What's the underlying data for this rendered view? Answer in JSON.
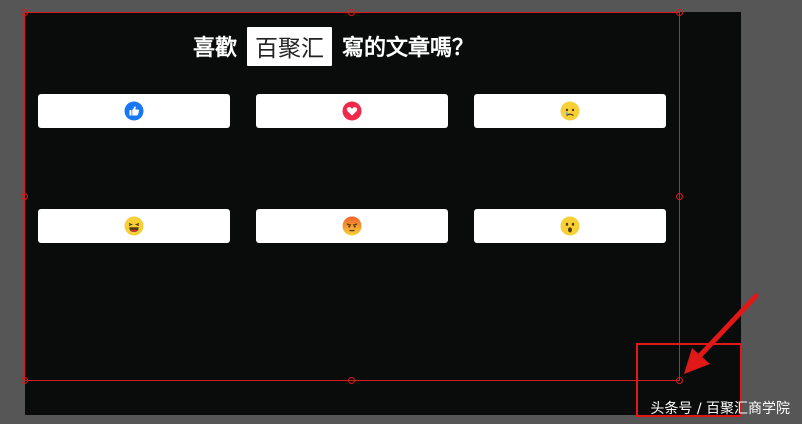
{
  "title": {
    "prefix": "喜歡",
    "brand": "百聚汇",
    "suffix": "寫的文章嗎？"
  },
  "reactions": [
    {
      "name": "like",
      "icon": "thumbs-up-icon",
      "color": "#1877f2"
    },
    {
      "name": "love",
      "icon": "heart-icon",
      "color": "#f0284a"
    },
    {
      "name": "sad",
      "icon": "sad-face-icon",
      "color": "#f7d038"
    },
    {
      "name": "haha",
      "icon": "laughing-face-icon",
      "color": "#f7d038"
    },
    {
      "name": "angry",
      "icon": "angry-face-icon",
      "color": "#f0612a"
    },
    {
      "name": "wow",
      "icon": "surprised-face-icon",
      "color": "#f7d038"
    }
  ],
  "colors": {
    "canvas_bg": "#0a0b0b",
    "workspace_bg": "#565656",
    "selection": "#d61d1d",
    "annotation": "#e01818"
  },
  "watermark": "头条号 / 百聚汇商学院"
}
